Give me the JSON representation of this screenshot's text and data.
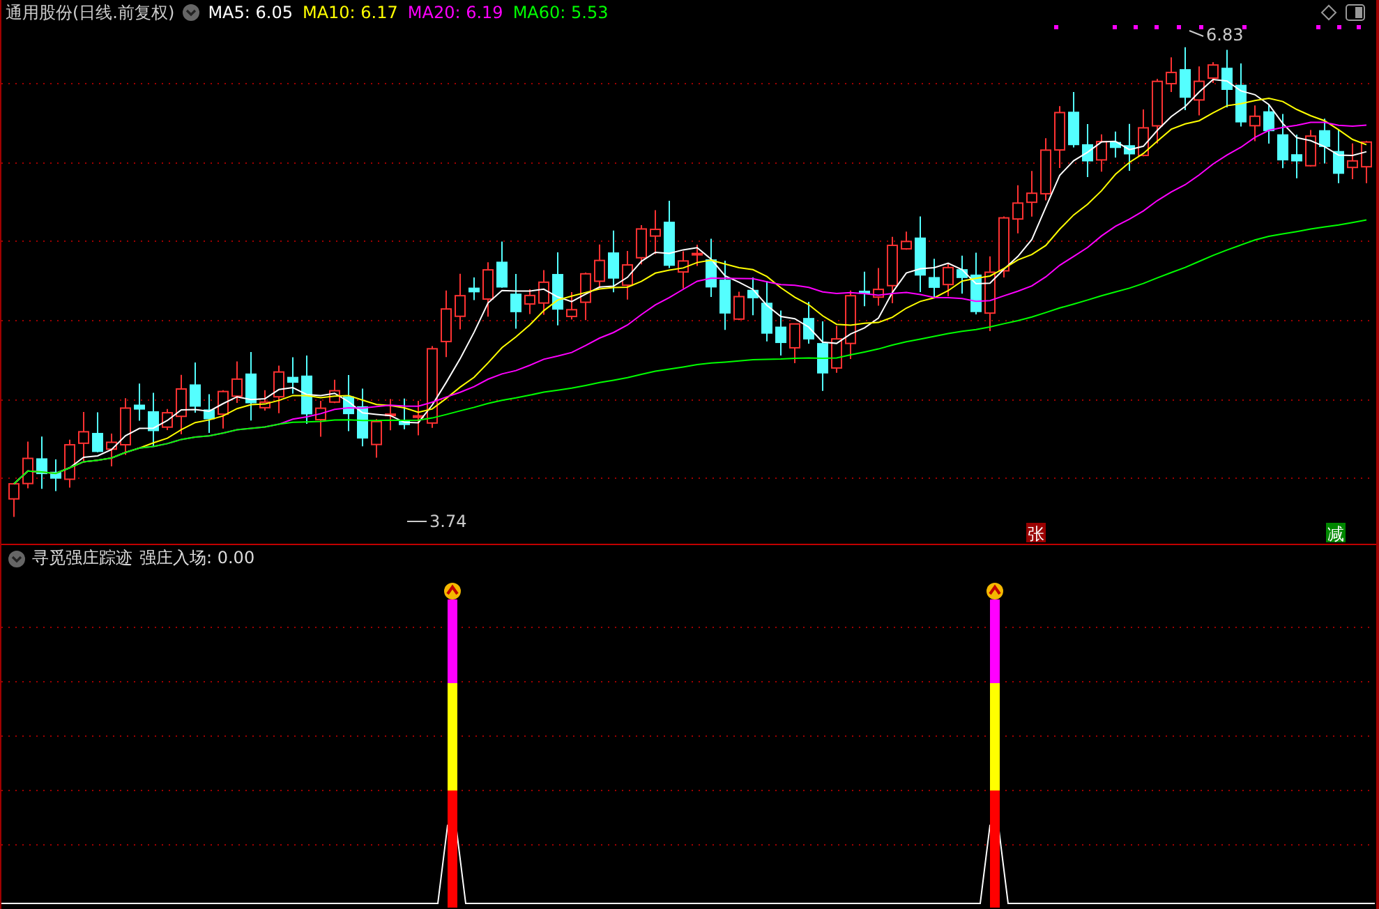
{
  "header": {
    "title": "通用股份(日线.前复权)",
    "moving_averages": [
      {
        "label": "MA5: 6.05",
        "color": "#ffffff"
      },
      {
        "label": "MA10: 6.17",
        "color": "#ffff00"
      },
      {
        "label": "MA20: 6.19",
        "color": "#ff00ff"
      },
      {
        "label": "MA60: 5.53",
        "color": "#00ff00"
      }
    ]
  },
  "price_chart": {
    "high_label": "6.83",
    "low_label": "3.74",
    "markers": [
      {
        "text": "张",
        "color": "#990000"
      },
      {
        "text": "减",
        "color": "#008800"
      }
    ]
  },
  "indicator": {
    "name": "寻觅强庄踪迹",
    "reading": "强庄入场: 0.00"
  }
}
